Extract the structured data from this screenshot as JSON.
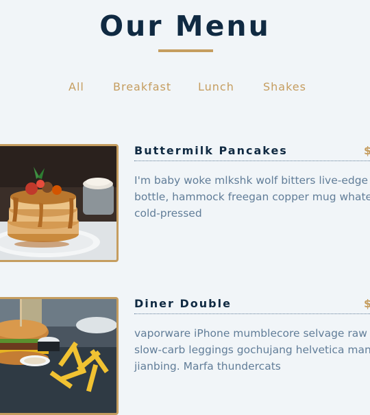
{
  "page": {
    "title": "Our Menu"
  },
  "filters": [
    {
      "label": "All"
    },
    {
      "label": "Breakfast"
    },
    {
      "label": "Lunch"
    },
    {
      "label": "Shakes"
    }
  ],
  "menu_items": [
    {
      "name": "Buttermilk Pancakes",
      "price": "$",
      "description_lines": [
        "I'm baby woke mlkshk wolf bitters live-edge blu",
        "bottle, hammock freegan copper mug whatev",
        "cold-pressed"
      ],
      "image": "pancakes-photo"
    },
    {
      "name": "Diner Double",
      "price": "$",
      "description_lines": [
        "vaporware iPhone mumblecore selvage raw d",
        "slow-carb leggings gochujang helvetica man b",
        "jianbing. Marfa thundercats"
      ],
      "image": "burger-photo"
    }
  ],
  "colors": {
    "background": "#f1f5f8",
    "accent": "#c59d5f",
    "heading": "#102a42",
    "body_text": "#617d98"
  }
}
